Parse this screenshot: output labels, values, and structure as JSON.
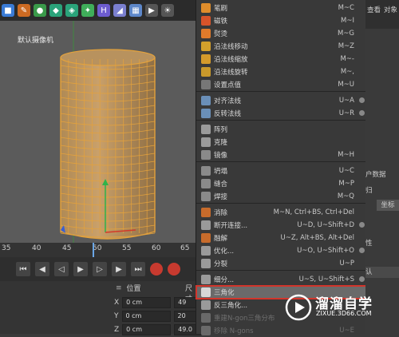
{
  "toolbar": {
    "icons": [
      "cube-icon",
      "pen-icon",
      "ball-icon",
      "object-icon",
      "nurbs-icon",
      "deformer-icon",
      "bend-icon",
      "camera-icon",
      "scene-icon",
      "light-icon"
    ]
  },
  "viewport": {
    "camera_label": "默认摄像机"
  },
  "timeline": {
    "ticks": [
      "35",
      "40",
      "45",
      "50",
      "55",
      "60",
      "65"
    ]
  },
  "coords": {
    "header_position": "位置",
    "header_size": "尺寸",
    "rows": [
      {
        "axis": "X",
        "value": "0 cm",
        "size": "49"
      },
      {
        "axis": "Y",
        "value": "0 cm",
        "size": "20"
      },
      {
        "axis": "Z",
        "value": "0 cm",
        "size": "49.0"
      }
    ]
  },
  "menu": {
    "items": [
      {
        "label": "笔刷",
        "shortcut": "M~C",
        "color": "#e08d2b"
      },
      {
        "label": "磁铁",
        "shortcut": "M~I",
        "color": "#d8542a"
      },
      {
        "label": "熨烫",
        "shortcut": "M~G",
        "color": "#e07a2b"
      },
      {
        "label": "沿法线移动",
        "shortcut": "M~Z",
        "color": "#d4a02b"
      },
      {
        "label": "沿法线缩放",
        "shortcut": "M~-",
        "color": "#d49a2b"
      },
      {
        "label": "沿法线旋转",
        "shortcut": "M~,",
        "color": "#c9992b"
      },
      {
        "label": "设置点值",
        "shortcut": "M~U",
        "color": "#777777"
      },
      {
        "label": "对齐法线",
        "shortcut": "U~A",
        "color": "#6a8fb8"
      },
      {
        "label": "反转法线",
        "shortcut": "U~R",
        "color": "#6a8fb8"
      },
      {
        "label": "阵列",
        "shortcut": "",
        "color": "#9a9a9a"
      },
      {
        "label": "克隆",
        "shortcut": "",
        "color": "#9a9a9a"
      },
      {
        "label": "镜像",
        "shortcut": "M~H",
        "color": "#8a8a8a"
      },
      {
        "label": "坍塌",
        "shortcut": "U~C",
        "color": "#8a8a8a"
      },
      {
        "label": "缝合",
        "shortcut": "M~P",
        "color": "#8a8a8a"
      },
      {
        "label": "焊接",
        "shortcut": "M~Q",
        "color": "#8a8a8a"
      },
      {
        "label": "消除",
        "shortcut": "M~N, Ctrl+BS, Ctrl+Del",
        "color": "#c76b2b"
      },
      {
        "label": "断开连接...",
        "shortcut": "U~D, U~Shift+D",
        "color": "#9a9a9a"
      },
      {
        "label": "融解",
        "shortcut": "U~Z, Alt+BS, Alt+Del",
        "color": "#c76b2b"
      },
      {
        "label": "优化...",
        "shortcut": "U~O, U~Shift+O",
        "color": "#9a9a9a"
      },
      {
        "label": "分裂",
        "shortcut": "U~P",
        "color": "#9a9a9a"
      },
      {
        "label": "细分...",
        "shortcut": "U~S, U~Shift+S",
        "color": "#9a9a9a"
      },
      {
        "label": "三角化",
        "shortcut": "",
        "color": "#d8d8d8"
      },
      {
        "label": "反三角化...",
        "shortcut": "",
        "color": "#9a9a9a"
      },
      {
        "label": "重建N-gon三角分布",
        "shortcut": "",
        "color": "#6a6a6a"
      },
      {
        "label": "移除 N-gons",
        "shortcut": "U~E",
        "color": "#6a6a6a"
      }
    ]
  },
  "right_panel": {
    "items": [
      "查看",
      "对象",
      "户数据",
      "归",
      "坐标",
      "性",
      "认"
    ]
  },
  "watermark": {
    "text": "溜溜自学",
    "url": "ZIXUE.3D66.COM"
  },
  "colors": {
    "accent_red": "#d2352b",
    "wire_orange": "#e4a23c"
  }
}
